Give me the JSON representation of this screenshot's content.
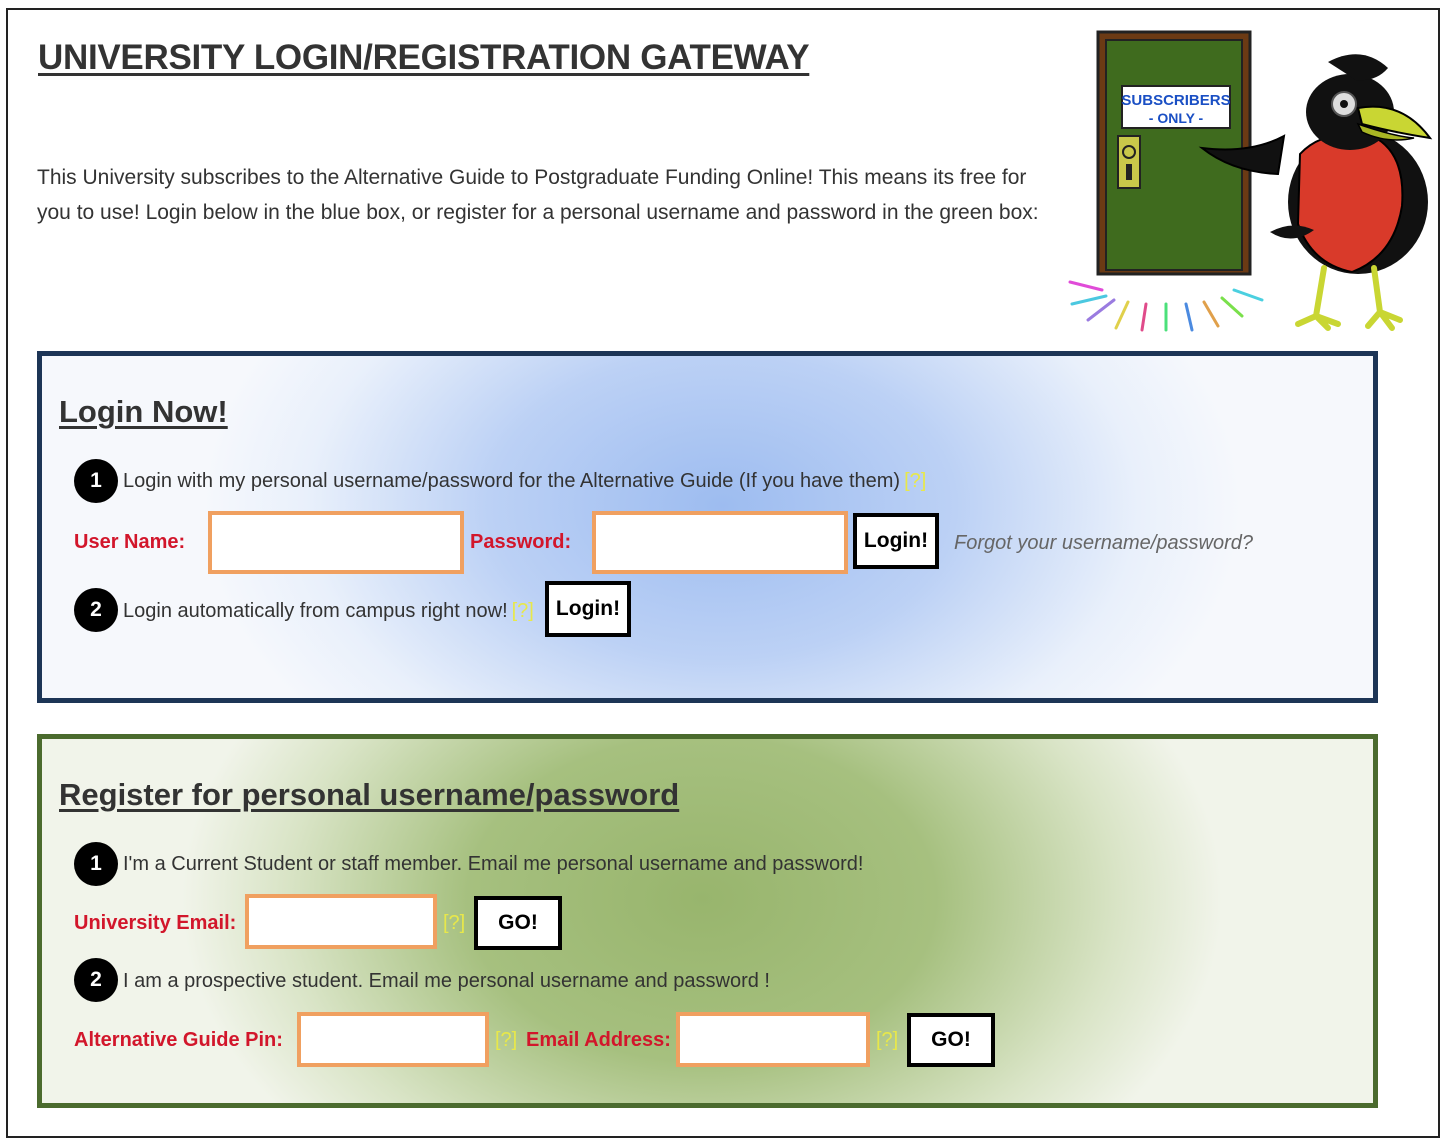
{
  "page": {
    "title": "UNIVERSITY LOGIN/REGISTRATION GATEWAY",
    "intro": "This University subscribes to the Alternative Guide to Postgraduate Funding Online! This means its free for you to use! Login below in the blue box, or register for a personal username and password in the green box:"
  },
  "mascot": {
    "sign_line1": "SUBSCRIBERS",
    "sign_line2": "- ONLY -",
    "door_color": "#3f6b1e",
    "bird_vest_color": "#d93a2a",
    "beak_color": "#c9d633"
  },
  "login": {
    "heading": "Login Now!",
    "step1_num": "1",
    "step1_text": "Login with my personal username/password for the Alternative Guide (If you have them)",
    "step1_help": "[?]",
    "username_label": "User Name:",
    "username_value": "",
    "password_label": "Password:",
    "password_value": "",
    "login_button": "Login!",
    "forgot_link": "Forgot your username/password?",
    "step2_num": "2",
    "step2_text": "Login automatically from campus right now!",
    "step2_help": "[?]",
    "campus_login_button": "Login!",
    "border_color": "#1d3556",
    "accent_color": "#9dbcf0"
  },
  "register": {
    "heading": "Register for personal username/password",
    "step1_num": "1",
    "step1_text": "I'm a Current Student or staff member. Email me personal username and password!",
    "university_email_label": "University Email:",
    "university_email_value": "",
    "university_email_help": "[?]",
    "go_button_1": "GO!",
    "step2_num": "2",
    "step2_text": "I am a prospective student. Email me personal username and password !",
    "pin_label": "Alternative Guide Pin:",
    "pin_value": "",
    "pin_help": "[?]",
    "email_label": "Email Address:",
    "email_value": "",
    "email_help": "[?]",
    "go_button_2": "GO!",
    "border_color": "#4b6b2e",
    "accent_color": "#98b56d"
  },
  "colors": {
    "label_red": "#d2162b",
    "input_border": "#f0a060",
    "help_yellow": "#e8e84a"
  }
}
